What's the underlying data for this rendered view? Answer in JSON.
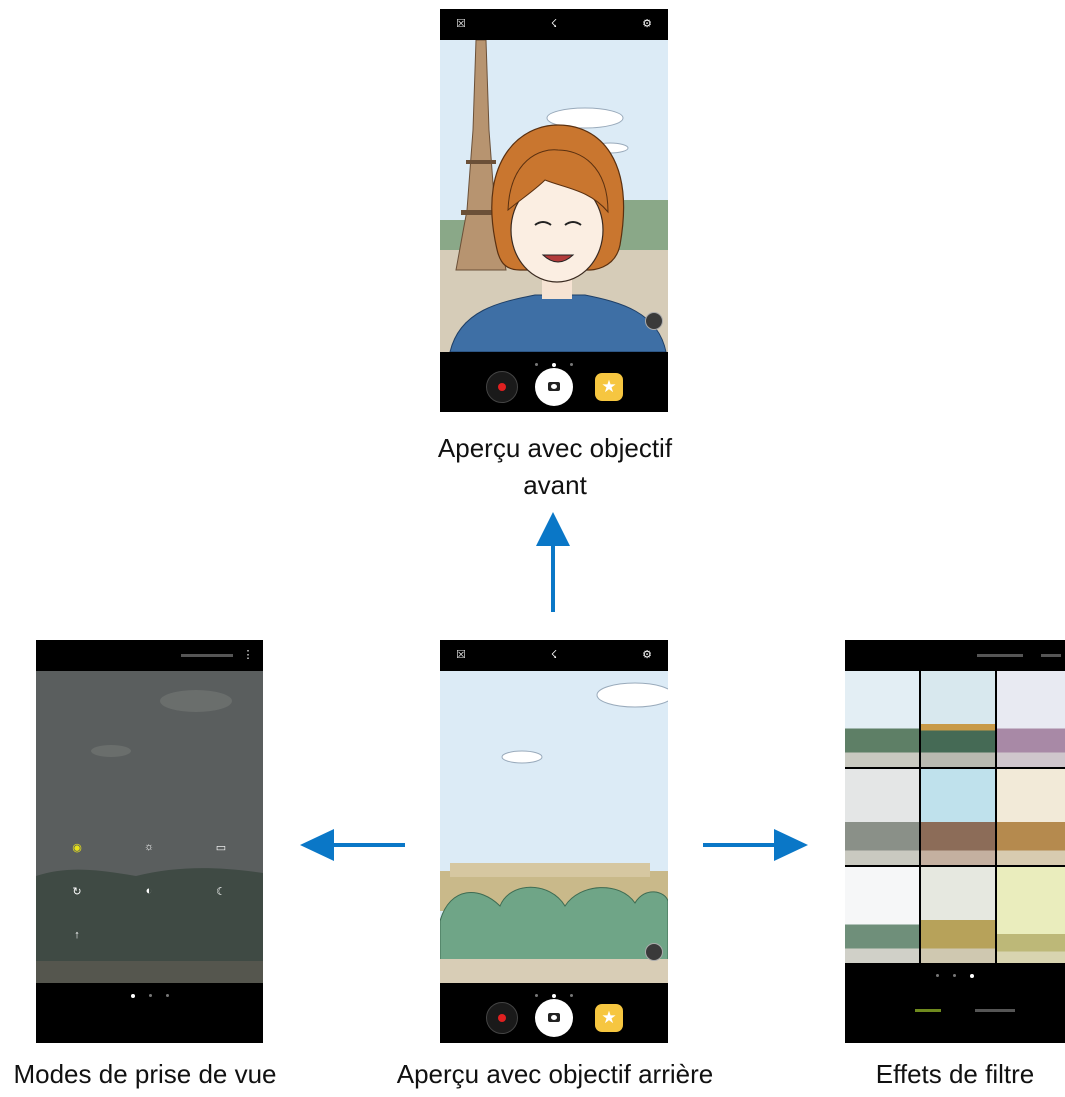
{
  "captions": {
    "front": "Aperçu avec objectif avant",
    "rear": "Aperçu avec objectif arrière",
    "modes": "Modes de prise de vue",
    "filters": "Effets de filtre"
  },
  "icons": {
    "switch_camera": "switch-camera-icon",
    "flash": "flash-off-icon",
    "settings": "gear-icon",
    "record": "record-icon",
    "shutter": "camera-shutter-icon",
    "effects": "star-effects-icon",
    "more": "more-vertical-icon"
  },
  "colors": {
    "arrow": "#0a77c7",
    "sky": "#dcebf6",
    "mode_selected": "#e8e21a",
    "effects_button": "#f6c640",
    "record_dot": "#e02020"
  },
  "pager": {
    "pages": 3,
    "active_page": 2
  },
  "shooting_modes": [
    {
      "name": "Auto",
      "icon": "camera-icon",
      "selected": true
    },
    {
      "name": "Pro",
      "icon": "aperture-icon",
      "selected": false
    },
    {
      "name": "Panorama",
      "icon": "panorama-icon",
      "selected": false
    },
    {
      "name": "Hyperlapse",
      "icon": "hyperlapse-icon",
      "selected": false
    },
    {
      "name": "HDR (Rich tone)",
      "icon": "hdr-icon",
      "selected": false
    },
    {
      "name": "Night",
      "icon": "moon-icon",
      "selected": false
    },
    {
      "name": "Food",
      "icon": "fork-icon",
      "selected": false
    }
  ]
}
